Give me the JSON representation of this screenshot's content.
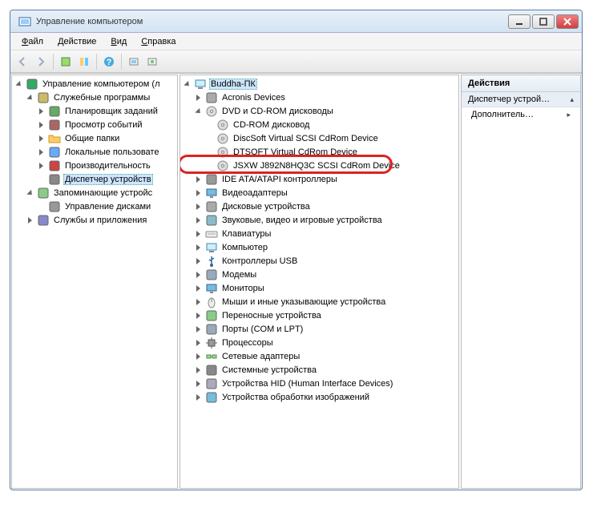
{
  "window": {
    "title": "Управление компьютером"
  },
  "menu": [
    "Файл",
    "Действие",
    "Вид",
    "Справка"
  ],
  "leftTree": [
    {
      "label": "Управление компьютером (л",
      "icon": "mgmt",
      "indent": 0,
      "children": true,
      "expanded": true
    },
    {
      "label": "Служебные программы",
      "icon": "tools",
      "indent": 1,
      "children": true,
      "expanded": true
    },
    {
      "label": "Планировщик заданий",
      "icon": "sched",
      "indent": 2,
      "children": true,
      "expanded": false
    },
    {
      "label": "Просмотр событий",
      "icon": "event",
      "indent": 2,
      "children": true,
      "expanded": false
    },
    {
      "label": "Общие папки",
      "icon": "folder",
      "indent": 2,
      "children": true,
      "expanded": false
    },
    {
      "label": "Локальные пользовате",
      "icon": "users",
      "indent": 2,
      "children": true,
      "expanded": false
    },
    {
      "label": "Производительность",
      "icon": "perf",
      "indent": 2,
      "children": true,
      "expanded": false
    },
    {
      "label": "Диспетчер устройств",
      "icon": "devmgr",
      "indent": 2,
      "children": false,
      "expanded": false,
      "selected": true
    },
    {
      "label": "Запоминающие устройс",
      "icon": "storage",
      "indent": 1,
      "children": true,
      "expanded": true
    },
    {
      "label": "Управление дисками",
      "icon": "disk",
      "indent": 2,
      "children": false,
      "expanded": false
    },
    {
      "label": "Службы и приложения",
      "icon": "services",
      "indent": 1,
      "children": true,
      "expanded": false
    }
  ],
  "midTree": [
    {
      "label": "Buddha-ПК",
      "icon": "computer",
      "indent": 0,
      "children": true,
      "expanded": true,
      "selected": true
    },
    {
      "label": "Acronis Devices",
      "icon": "hw",
      "indent": 1,
      "children": true,
      "expanded": false
    },
    {
      "label": "DVD и CD-ROM дисководы",
      "icon": "cd",
      "indent": 1,
      "children": true,
      "expanded": true
    },
    {
      "label": "CD-ROM дисковод",
      "icon": "cd",
      "indent": 2,
      "children": false
    },
    {
      "label": "DiscSoft Virtual SCSI CdRom Device",
      "icon": "cd",
      "indent": 2,
      "children": false
    },
    {
      "label": "DTSOFT Virtual CdRom Device",
      "icon": "cd",
      "indent": 2,
      "children": false
    },
    {
      "label": "JSXW J892N8HQ3C SCSI CdRom Device",
      "icon": "cd",
      "indent": 2,
      "children": false,
      "highlighted": true
    },
    {
      "label": "IDE ATA/ATAPI контроллеры",
      "icon": "ide",
      "indent": 1,
      "children": true,
      "expanded": false
    },
    {
      "label": "Видеоадаптеры",
      "icon": "video",
      "indent": 1,
      "children": true,
      "expanded": false
    },
    {
      "label": "Дисковые устройства",
      "icon": "disk2",
      "indent": 1,
      "children": true,
      "expanded": false
    },
    {
      "label": "Звуковые, видео и игровые устройства",
      "icon": "sound",
      "indent": 1,
      "children": true,
      "expanded": false
    },
    {
      "label": "Клавиатуры",
      "icon": "kbd",
      "indent": 1,
      "children": true,
      "expanded": false
    },
    {
      "label": "Компьютер",
      "icon": "computer",
      "indent": 1,
      "children": true,
      "expanded": false
    },
    {
      "label": "Контроллеры USB",
      "icon": "usb",
      "indent": 1,
      "children": true,
      "expanded": false
    },
    {
      "label": "Модемы",
      "icon": "modem",
      "indent": 1,
      "children": true,
      "expanded": false
    },
    {
      "label": "Мониторы",
      "icon": "monitor",
      "indent": 1,
      "children": true,
      "expanded": false
    },
    {
      "label": "Мыши и иные указывающие устройства",
      "icon": "mouse",
      "indent": 1,
      "children": true,
      "expanded": false
    },
    {
      "label": "Переносные устройства",
      "icon": "portable",
      "indent": 1,
      "children": true,
      "expanded": false
    },
    {
      "label": "Порты (COM и LPT)",
      "icon": "port",
      "indent": 1,
      "children": true,
      "expanded": false
    },
    {
      "label": "Процессоры",
      "icon": "cpu",
      "indent": 1,
      "children": true,
      "expanded": false
    },
    {
      "label": "Сетевые адаптеры",
      "icon": "net",
      "indent": 1,
      "children": true,
      "expanded": false
    },
    {
      "label": "Системные устройства",
      "icon": "sys",
      "indent": 1,
      "children": true,
      "expanded": false
    },
    {
      "label": "Устройства HID (Human Interface Devices)",
      "icon": "hid",
      "indent": 1,
      "children": true,
      "expanded": false
    },
    {
      "label": "Устройства обработки изображений",
      "icon": "img",
      "indent": 1,
      "children": true,
      "expanded": false
    }
  ],
  "actions": {
    "header": "Действия",
    "section": "Диспетчер устрой…",
    "item": "Дополнитель…"
  },
  "icons": {
    "mgmt": "#3a6",
    "tools": "#cb6",
    "sched": "#6a6",
    "event": "#a66",
    "folder": "#fc6",
    "users": "#6af",
    "perf": "#c44",
    "devmgr": "#888",
    "storage": "#8c8",
    "disk": "#999",
    "services": "#88c",
    "computer": "#6af",
    "hw": "#aaa",
    "cd": "#bbb",
    "ide": "#999",
    "video": "#7bd",
    "disk2": "#aaa",
    "sound": "#8bc",
    "kbd": "#bbb",
    "usb": "#6af",
    "modem": "#9ab",
    "monitor": "#7bd",
    "mouse": "#bbb",
    "portable": "#8c8",
    "port": "#9ab",
    "cpu": "#888",
    "net": "#6a6",
    "sys": "#888",
    "hid": "#aab",
    "img": "#7bd"
  }
}
